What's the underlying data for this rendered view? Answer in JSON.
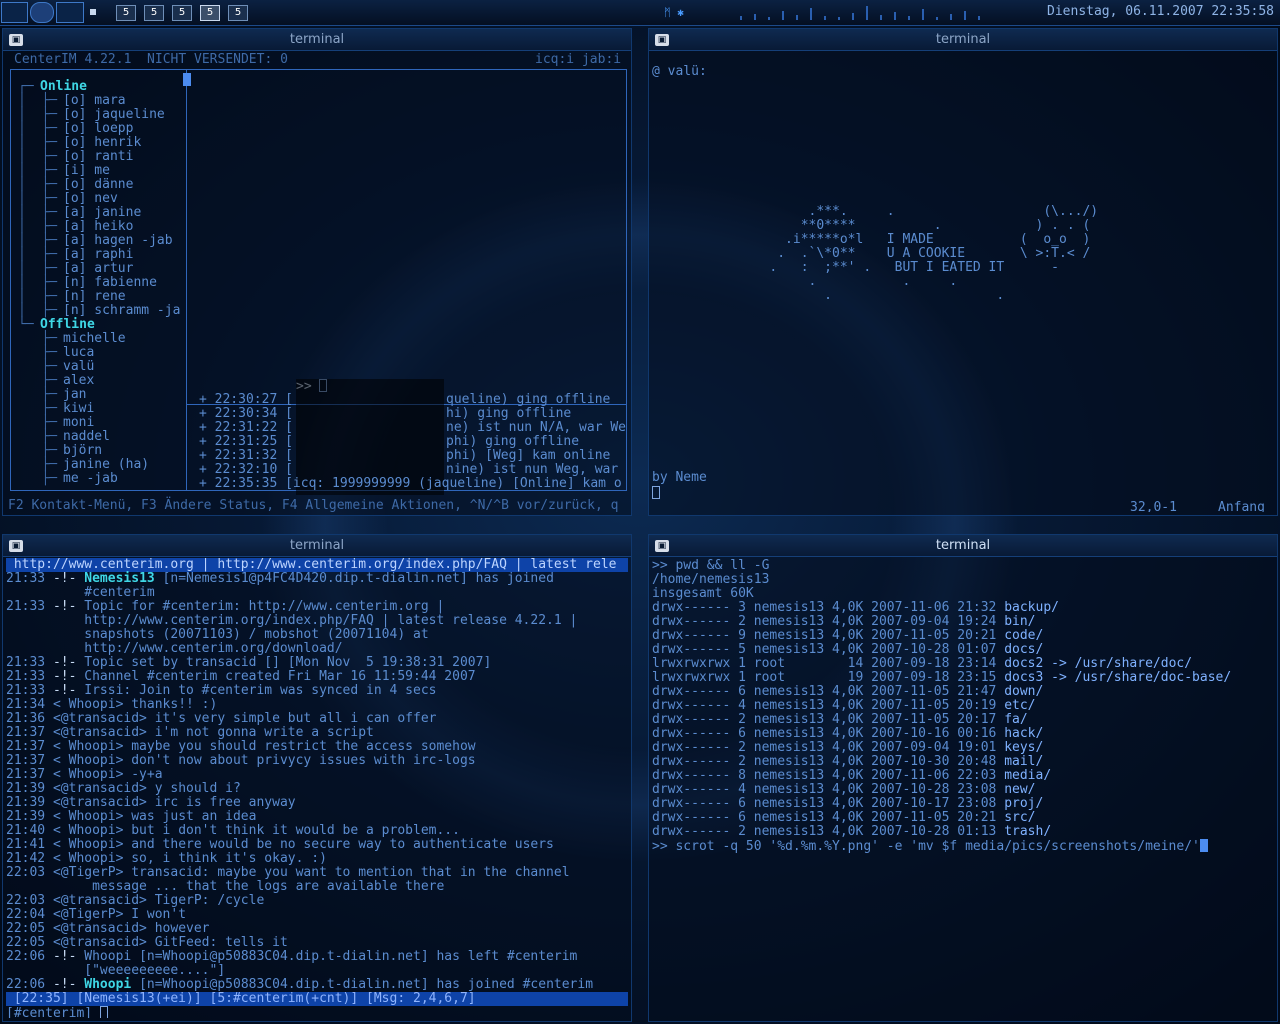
{
  "panel": {
    "clock": "Dienstag, 06.11.2007 22:35:58",
    "workspaces": [
      "5",
      "5",
      "5",
      "5",
      "5"
    ],
    "active_workspace": 3
  },
  "terminals": {
    "title": "terminal"
  },
  "centerim": {
    "header_left": "CenterIM 4.22.1  NICHT VERSENDET: 0",
    "header_right": "icq:i jab:i",
    "groups": [
      {
        "name": "Online",
        "contacts": [
          "[o] mara",
          "[o] jaqueline",
          "[o] loepp",
          "[o] henrik",
          "[o] ranti",
          "[i] me",
          "[o] dänne",
          "[o] nev",
          "[a] janine",
          "[a] heiko",
          "[a] hagen -jab",
          "[a] raphi",
          "[a] artur",
          "[n] fabienne",
          "[n] rene",
          "[n] schramm -ja"
        ]
      },
      {
        "name": "Offline",
        "contacts": [
          "michelle",
          "luca",
          "valü",
          "alex",
          "jan",
          "kiwi",
          "moni",
          "naddel",
          "björn",
          "janine (ha)",
          "me -jab"
        ]
      }
    ],
    "prompt": ">>",
    "log": [
      "+ 22:30:27 [",
      "+ 22:30:34 [",
      "+ 22:31:22 [",
      "+ 22:31:25 [",
      "+ 22:31:32 [",
      "+ 22:32:10 [",
      "+ 22:35:35 [icq: 1999999999 (jaqueline) [Online] kam o"
    ],
    "log_tails": [
      "queline) ging offline",
      "hi) ging offline",
      "ne) ist nun N/A, war We",
      "phi) ging offline",
      "phi) [Weg] kam online",
      "nine) ist nun Weg, war",
      ""
    ],
    "footer": "F2 Kontakt-Menü, F3 Ändere Status, F4 Allgemeine Aktionen, ^N/^B vor/zurück, q"
  },
  "vim": {
    "lines": [
      "@ valü:",
      "",
      "",
      "",
      "",
      "",
      "",
      "",
      "",
      "",
      "                    .***.     .                   (\\.../)",
      "                   **0****          .            ) . . (",
      "                 .i*****o*l   I MADE           (  o_o  )",
      "                .  .`\\*0**    U A COOKIE       \\ >:T.< /",
      "               .   :  ;**' .   BUT I EATED IT      -",
      "                    .           .     .",
      "                      .                     .",
      "",
      "",
      "",
      "",
      "",
      "",
      "",
      "",
      "",
      "",
      "",
      "",
      "by Neme"
    ],
    "position": "32,0-1",
    "scroll": "Anfang"
  },
  "irssi": {
    "topic_bar": " http://www.centerim.org | http://www.centerim.org/index.php/FAQ | latest rele",
    "lines": [
      {
        "t": "21:33",
        "s": "-!-",
        "n": "Nemesis13",
        "m": " [n=Nemesis1@p4FC4D420.dip.t-dialin.net] has joined"
      },
      {
        "t": "",
        "s": "",
        "n": "",
        "m": "          #centerim"
      },
      {
        "t": "21:33",
        "s": "-!-",
        "n": "",
        "m": " Topic for #centerim: http://www.centerim.org |"
      },
      {
        "t": "",
        "s": "",
        "n": "",
        "m": "          http://www.centerim.org/index.php/FAQ | latest release 4.22.1 |"
      },
      {
        "t": "",
        "s": "",
        "n": "",
        "m": "          snapshots (20071103) / mobshot (20071104) at"
      },
      {
        "t": "",
        "s": "",
        "n": "",
        "m": "          http://www.centerim.org/download/"
      },
      {
        "t": "21:33",
        "s": "-!-",
        "n": "",
        "m": " Topic set by transacid [] [Mon Nov  5 19:38:31 2007]"
      },
      {
        "t": "21:33",
        "s": "-!-",
        "n": "",
        "m": " Channel #centerim created Fri Mar 16 11:59:44 2007"
      },
      {
        "t": "21:33",
        "s": "-!-",
        "n": "",
        "m": " Irssi: Join to #centerim was synced in 4 secs"
      },
      {
        "t": "21:34",
        "s": "",
        "n": "",
        "m": " < Whoopi> thanks!! :)"
      },
      {
        "t": "21:36",
        "s": "",
        "n": "",
        "m": " <@transacid> it's very simple but all i can offer"
      },
      {
        "t": "21:37",
        "s": "",
        "n": "",
        "m": " <@transacid> i'm not gonna write a script"
      },
      {
        "t": "21:37",
        "s": "",
        "n": "",
        "m": " < Whoopi> maybe you should restrict the access somehow"
      },
      {
        "t": "21:37",
        "s": "",
        "n": "",
        "m": " < Whoopi> don't now about privycy issues with irc-logs"
      },
      {
        "t": "21:37",
        "s": "",
        "n": "",
        "m": " < Whoopi> -y+a"
      },
      {
        "t": "21:39",
        "s": "",
        "n": "",
        "m": " <@transacid> y should i?"
      },
      {
        "t": "21:39",
        "s": "",
        "n": "",
        "m": " <@transacid> irc is free anyway"
      },
      {
        "t": "21:39",
        "s": "",
        "n": "",
        "m": " < Whoopi> was just an idea"
      },
      {
        "t": "21:40",
        "s": "",
        "n": "",
        "m": " < Whoopi> but i don't think it would be a problem..."
      },
      {
        "t": "21:41",
        "s": "",
        "n": "",
        "m": " < Whoopi> and there would be no secure way to authenticate users"
      },
      {
        "t": "21:42",
        "s": "",
        "n": "",
        "m": " < Whoopi> so, i think it's okay. :)"
      },
      {
        "t": "22:03",
        "s": "",
        "n": "",
        "m": " <@TigerP> transacid: maybe you want to mention that in the channel"
      },
      {
        "t": "",
        "s": "",
        "n": "",
        "m": "           message ... that the logs are available there"
      },
      {
        "t": "22:03",
        "s": "",
        "n": "",
        "m": " <@transacid> TigerP: /cycle"
      },
      {
        "t": "22:04",
        "s": "",
        "n": "",
        "m": " <@TigerP> I won't"
      },
      {
        "t": "22:05",
        "s": "",
        "n": "",
        "m": " <@transacid> however"
      },
      {
        "t": "22:05",
        "s": "",
        "n": "",
        "m": " <@transacid> GitFeed: tells it"
      },
      {
        "t": "22:06",
        "s": "-!-",
        "n": "",
        "m": " Whoopi [n=Whoopi@p50883C04.dip.t-dialin.net] has left #centerim"
      },
      {
        "t": "",
        "s": "",
        "n": "",
        "m": "          [\"weeeeeeeee....\"]"
      },
      {
        "t": "22:06",
        "s": "-!-",
        "n": "Whoopi",
        "m": " [n=Whoopi@p50883C04.dip.t-dialin.net] has joined #centerim"
      }
    ],
    "status_bar": " [22:35] [Nemesis13(+ei)] [5:#centerim(+cnt)] [Msg: 2,4,6,7]",
    "input": "[#centerim] "
  },
  "shell": {
    "lines": [
      ">> pwd && ll -G",
      "/home/nemesis13",
      "insgesamt 60K",
      "drwx------ 3 nemesis13 4,0K 2007-11-06 21:32 |backup/",
      "drwx------ 2 nemesis13 4,0K 2007-09-04 19:24 |bin/",
      "drwx------ 9 nemesis13 4,0K 2007-11-05 20:21 |code/",
      "drwx------ 5 nemesis13 4,0K 2007-10-28 01:07 |docs/",
      "lrwxrwxrwx 1 root        14 2007-09-18 23:14 |docs2 -> /usr/share/doc/",
      "lrwxrwxrwx 1 root        19 2007-09-18 23:15 |docs3 -> /usr/share/doc-base/",
      "drwx------ 6 nemesis13 4,0K 2007-11-05 21:47 |down/",
      "drwx------ 4 nemesis13 4,0K 2007-11-05 20:19 |etc/",
      "drwx------ 2 nemesis13 4,0K 2007-11-05 20:17 |fa/",
      "drwx------ 6 nemesis13 4,0K 2007-10-16 00:16 |hack/",
      "drwx------ 2 nemesis13 4,0K 2007-09-04 19:01 |keys/",
      "drwx------ 2 nemesis13 4,0K 2007-10-30 20:48 |mail/",
      "drwx------ 8 nemesis13 4,0K 2007-11-06 22:03 |media/",
      "drwx------ 4 nemesis13 4,0K 2007-10-28 23:08 |new/",
      "drwx------ 6 nemesis13 4,0K 2007-10-17 23:08 |proj/",
      "drwx------ 6 nemesis13 4,0K 2007-11-05 20:21 |src/",
      "drwx------ 2 nemesis13 4,0K 2007-10-28 01:13 |trash/",
      ">> scrot -q 50 '%d.%m.%Y.png' -e 'mv $f media/pics/screenshots/meine/'"
    ]
  }
}
